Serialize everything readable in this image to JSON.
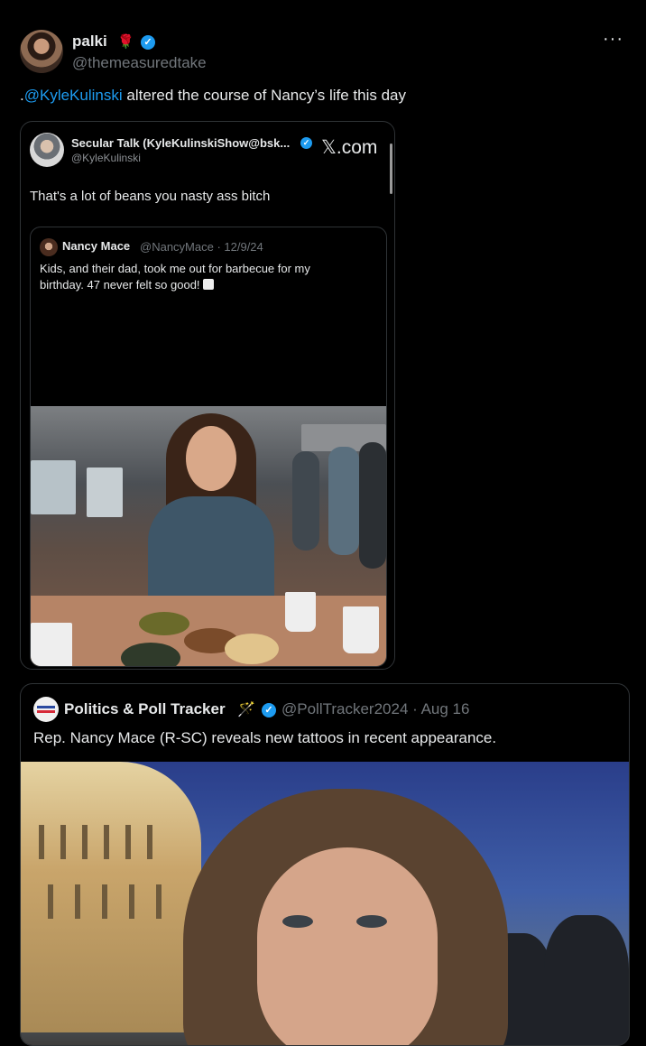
{
  "main_tweet": {
    "author_name": "palki",
    "author_emoji": "🌹",
    "handle": "@themeasuredtake",
    "text_prefix": ".",
    "mention": "@KyleKulinski",
    "text_rest": " altered the course of Nancy’s life this day",
    "more_label": "···"
  },
  "embed_card": {
    "author_name": "Secular Talk (KyleKulinskiShow@bsk...",
    "handle": "@KyleKulinski",
    "site_label": "𝕏.com",
    "text": "That's a lot of beans you nasty ass bitch",
    "quoted": {
      "author_name": "Nancy Mace",
      "meta": "@NancyMace · 12/9/24",
      "text": "Kids, and their dad, took me out for barbecue for my birthday. 47 never felt so good!"
    }
  },
  "quote_card": {
    "author_name": "Politics & Poll Tracker",
    "author_icon": "🪄",
    "handle": "@PollTracker2024 · Aug 16",
    "text": "Rep. Nancy Mace (R-SC) reveals new tattoos in recent appearance."
  },
  "colors": {
    "background": "#000000",
    "link": "#1d9bf0",
    "secondary_text": "#71767b",
    "border": "#2f3336"
  }
}
